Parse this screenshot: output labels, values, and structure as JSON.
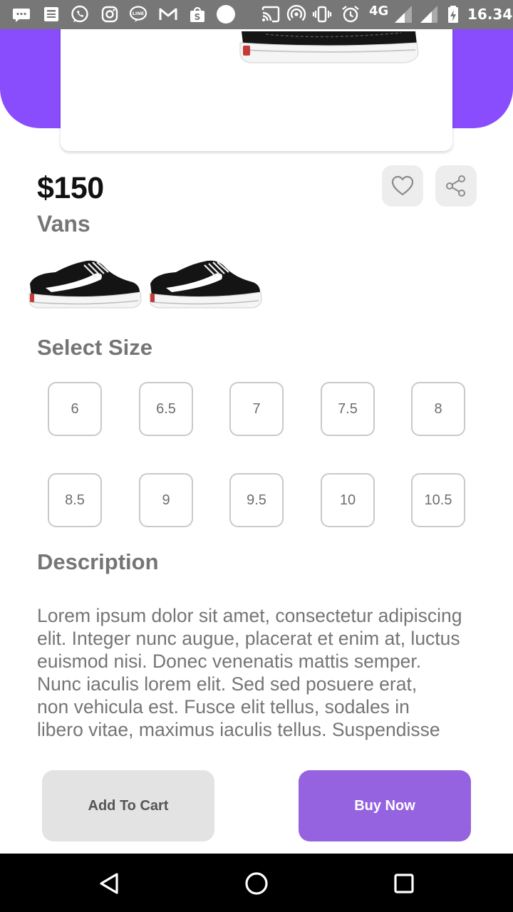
{
  "status_bar": {
    "network": "4G",
    "time": "16.34",
    "icons": [
      "chat-icon",
      "news-icon",
      "whatsapp-icon",
      "instagram-icon",
      "line-icon",
      "gmail-icon",
      "shopee-icon",
      "circle-icon",
      "cast-icon",
      "hotspot-icon",
      "vibrate-icon",
      "alarm-icon",
      "signal-icon",
      "signal-icon",
      "battery-charging-icon"
    ]
  },
  "colors": {
    "accent": "#8a4dfd",
    "buy_button": "#9563e0",
    "cart_button": "#e3e3e3",
    "muted_text": "#757575"
  },
  "product": {
    "price": "$150",
    "brand": "Vans",
    "thumbnails": [
      "shoe-thumbnail",
      "shoe-thumbnail"
    ]
  },
  "actions": {
    "favorite_icon": "heart-icon",
    "share_icon": "share-icon"
  },
  "sizes": {
    "heading": "Select Size",
    "options": [
      "6",
      "6.5",
      "7",
      "7.5",
      "8",
      "8.5",
      "9",
      "9.5",
      "10",
      "10.5"
    ]
  },
  "description": {
    "heading": "Description",
    "lines": [
      "Lorem ipsum dolor sit amet, consectetur adipiscing",
      "elit. Integer nunc augue, placerat et enim at, luctus",
      "euismod nisi. Donec venenatis mattis semper.",
      "Nunc iaculis lorem elit. Sed sed posuere erat,",
      "non vehicula est. Fusce elit tellus, sodales in",
      "libero vitae, maximus iaculis tellus. Suspendisse"
    ]
  },
  "buttons": {
    "add_to_cart": "Add To Cart",
    "buy_now": "Buy Now"
  },
  "nav": {
    "back_icon": "back-triangle-icon",
    "home_icon": "home-circle-icon",
    "recents_icon": "recents-square-icon"
  }
}
